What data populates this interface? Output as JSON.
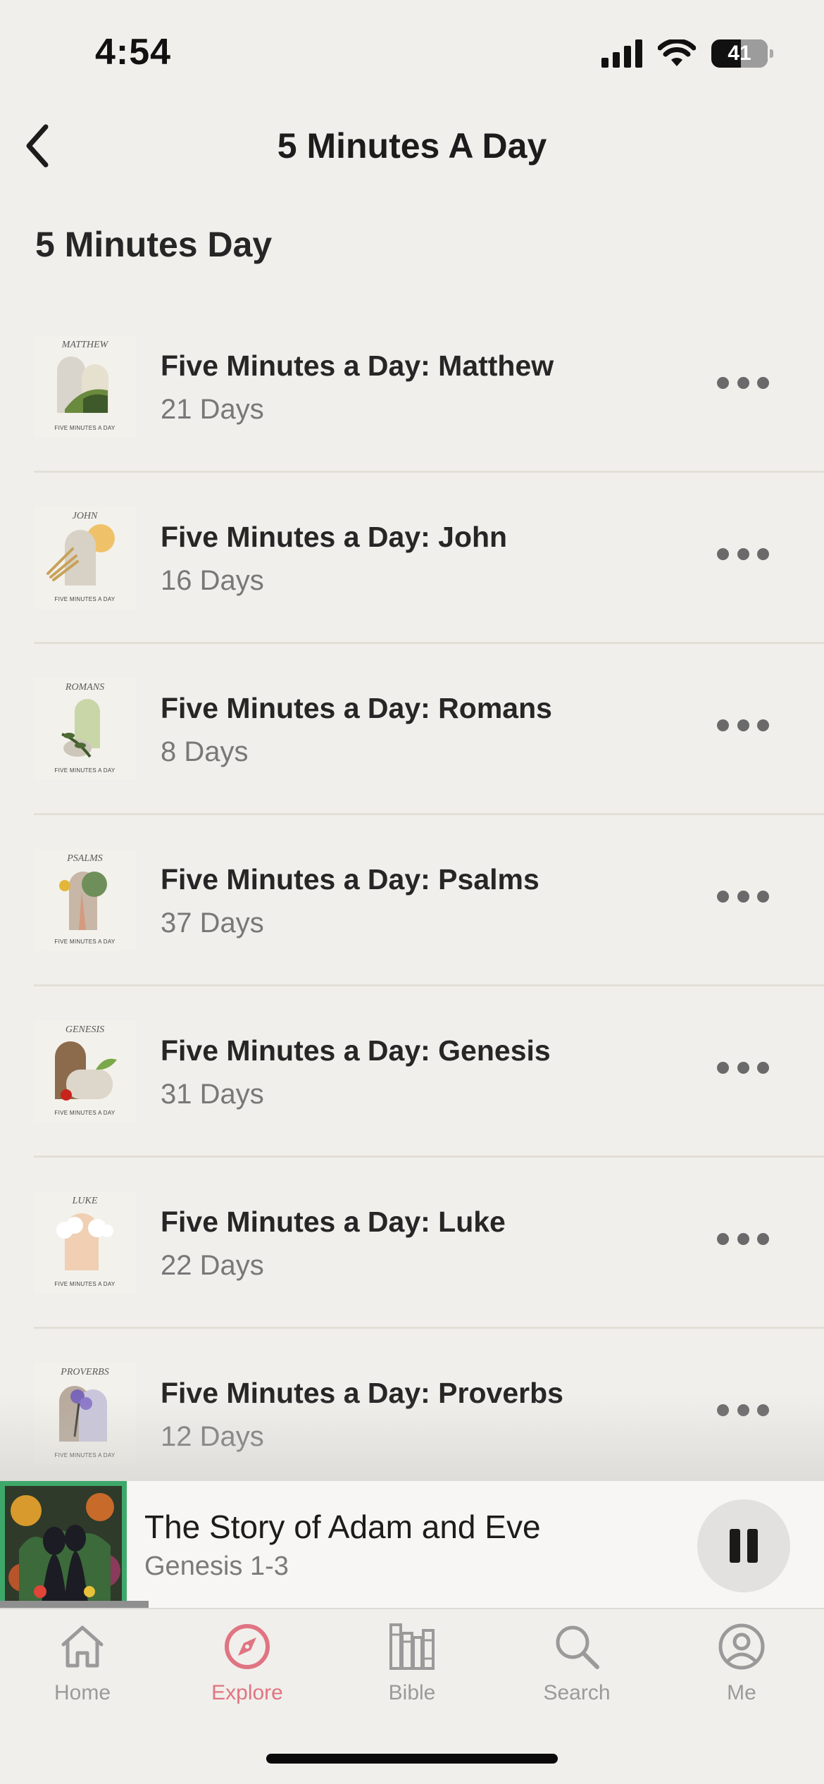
{
  "status_bar": {
    "time": "4:54",
    "battery": "41",
    "icons": [
      "signal-icon",
      "wifi-icon",
      "battery-icon"
    ]
  },
  "header": {
    "title": "5 Minutes A Day",
    "back_icon": "chevron-left-icon"
  },
  "section": {
    "title": "5 Minutes Day"
  },
  "plans": [
    {
      "title": "Five Minutes a Day: Matthew",
      "days": "21 Days",
      "thumb_label": "MATTHEW",
      "thumb_footer": "FIVE MINUTES A DAY"
    },
    {
      "title": "Five Minutes a Day: John",
      "days": "16 Days",
      "thumb_label": "JOHN",
      "thumb_footer": "FIVE MINUTES A DAY"
    },
    {
      "title": "Five Minutes a Day: Romans",
      "days": "8 Days",
      "thumb_label": "ROMANS",
      "thumb_footer": "FIVE MINUTES A DAY"
    },
    {
      "title": "Five Minutes a Day: Psalms",
      "days": "37 Days",
      "thumb_label": "PSALMS",
      "thumb_footer": "FIVE MINUTES A DAY"
    },
    {
      "title": "Five Minutes a Day: Genesis",
      "days": "31 Days",
      "thumb_label": "GENESIS",
      "thumb_footer": "FIVE MINUTES A DAY"
    },
    {
      "title": "Five Minutes a Day: Luke",
      "days": "22 Days",
      "thumb_label": "LUKE",
      "thumb_footer": "FIVE MINUTES A DAY"
    },
    {
      "title": "Five Minutes a Day: Proverbs",
      "days": "12 Days",
      "thumb_label": "PROVERBS",
      "thumb_footer": "FIVE MINUTES A DAY"
    }
  ],
  "now_playing": {
    "title": "The Story of Adam and Eve",
    "subtitle": "Genesis 1-3",
    "progress": 0.18,
    "state_icon": "pause-icon"
  },
  "tabs": [
    {
      "label": "Home",
      "icon": "home-icon",
      "active": false
    },
    {
      "label": "Explore",
      "icon": "compass-icon",
      "active": true
    },
    {
      "label": "Bible",
      "icon": "bible-books-icon",
      "active": false
    },
    {
      "label": "Search",
      "icon": "search-icon",
      "active": false
    },
    {
      "label": "Me",
      "icon": "profile-icon",
      "active": false
    }
  ],
  "colors": {
    "background": "#f1efeb",
    "accent": "#e07482",
    "player_art_border": "#3ea86a"
  }
}
